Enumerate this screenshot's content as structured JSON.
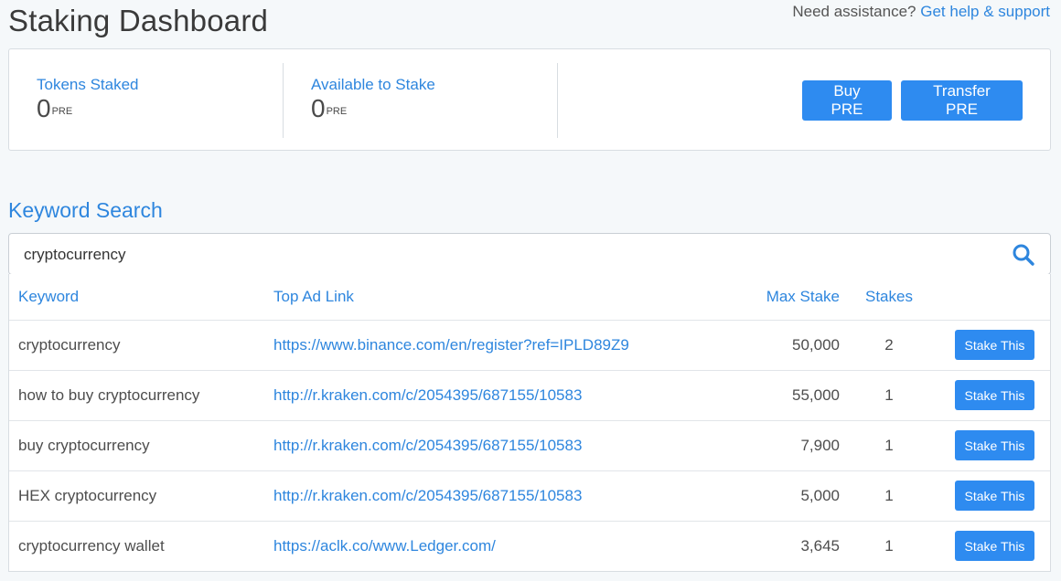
{
  "header": {
    "title": "Staking Dashboard",
    "help_prefix": "Need assistance?",
    "help_link": "Get help & support"
  },
  "stats": {
    "tokens_staked_label": "Tokens Staked",
    "tokens_staked_value": "0",
    "tokens_staked_unit": "PRE",
    "available_label": "Available to Stake",
    "available_value": "0",
    "available_unit": "PRE",
    "buy_label": "Buy PRE",
    "transfer_label": "Transfer PRE"
  },
  "search": {
    "title": "Keyword Search",
    "value": "cryptocurrency"
  },
  "table": {
    "columns": [
      "Keyword",
      "Top Ad Link",
      "Max Stake",
      "Stakes",
      ""
    ],
    "stake_button_label": "Stake This",
    "rows": [
      {
        "keyword": "cryptocurrency",
        "link": "https://www.binance.com/en/register?ref=IPLD89Z9",
        "max_stake": "50,000",
        "stakes": "2"
      },
      {
        "keyword": "how to buy cryptocurrency",
        "link": "http://r.kraken.com/c/2054395/687155/10583",
        "max_stake": "55,000",
        "stakes": "1"
      },
      {
        "keyword": "buy cryptocurrency",
        "link": "http://r.kraken.com/c/2054395/687155/10583",
        "max_stake": "7,900",
        "stakes": "1"
      },
      {
        "keyword": "HEX cryptocurrency",
        "link": "http://r.kraken.com/c/2054395/687155/10583",
        "max_stake": "5,000",
        "stakes": "1"
      },
      {
        "keyword": "cryptocurrency wallet",
        "link": "https://aclk.co/www.Ledger.com/",
        "max_stake": "3,645",
        "stakes": "1"
      }
    ]
  },
  "colors": {
    "accent": "#2e86de",
    "button": "#2e8bf0"
  }
}
